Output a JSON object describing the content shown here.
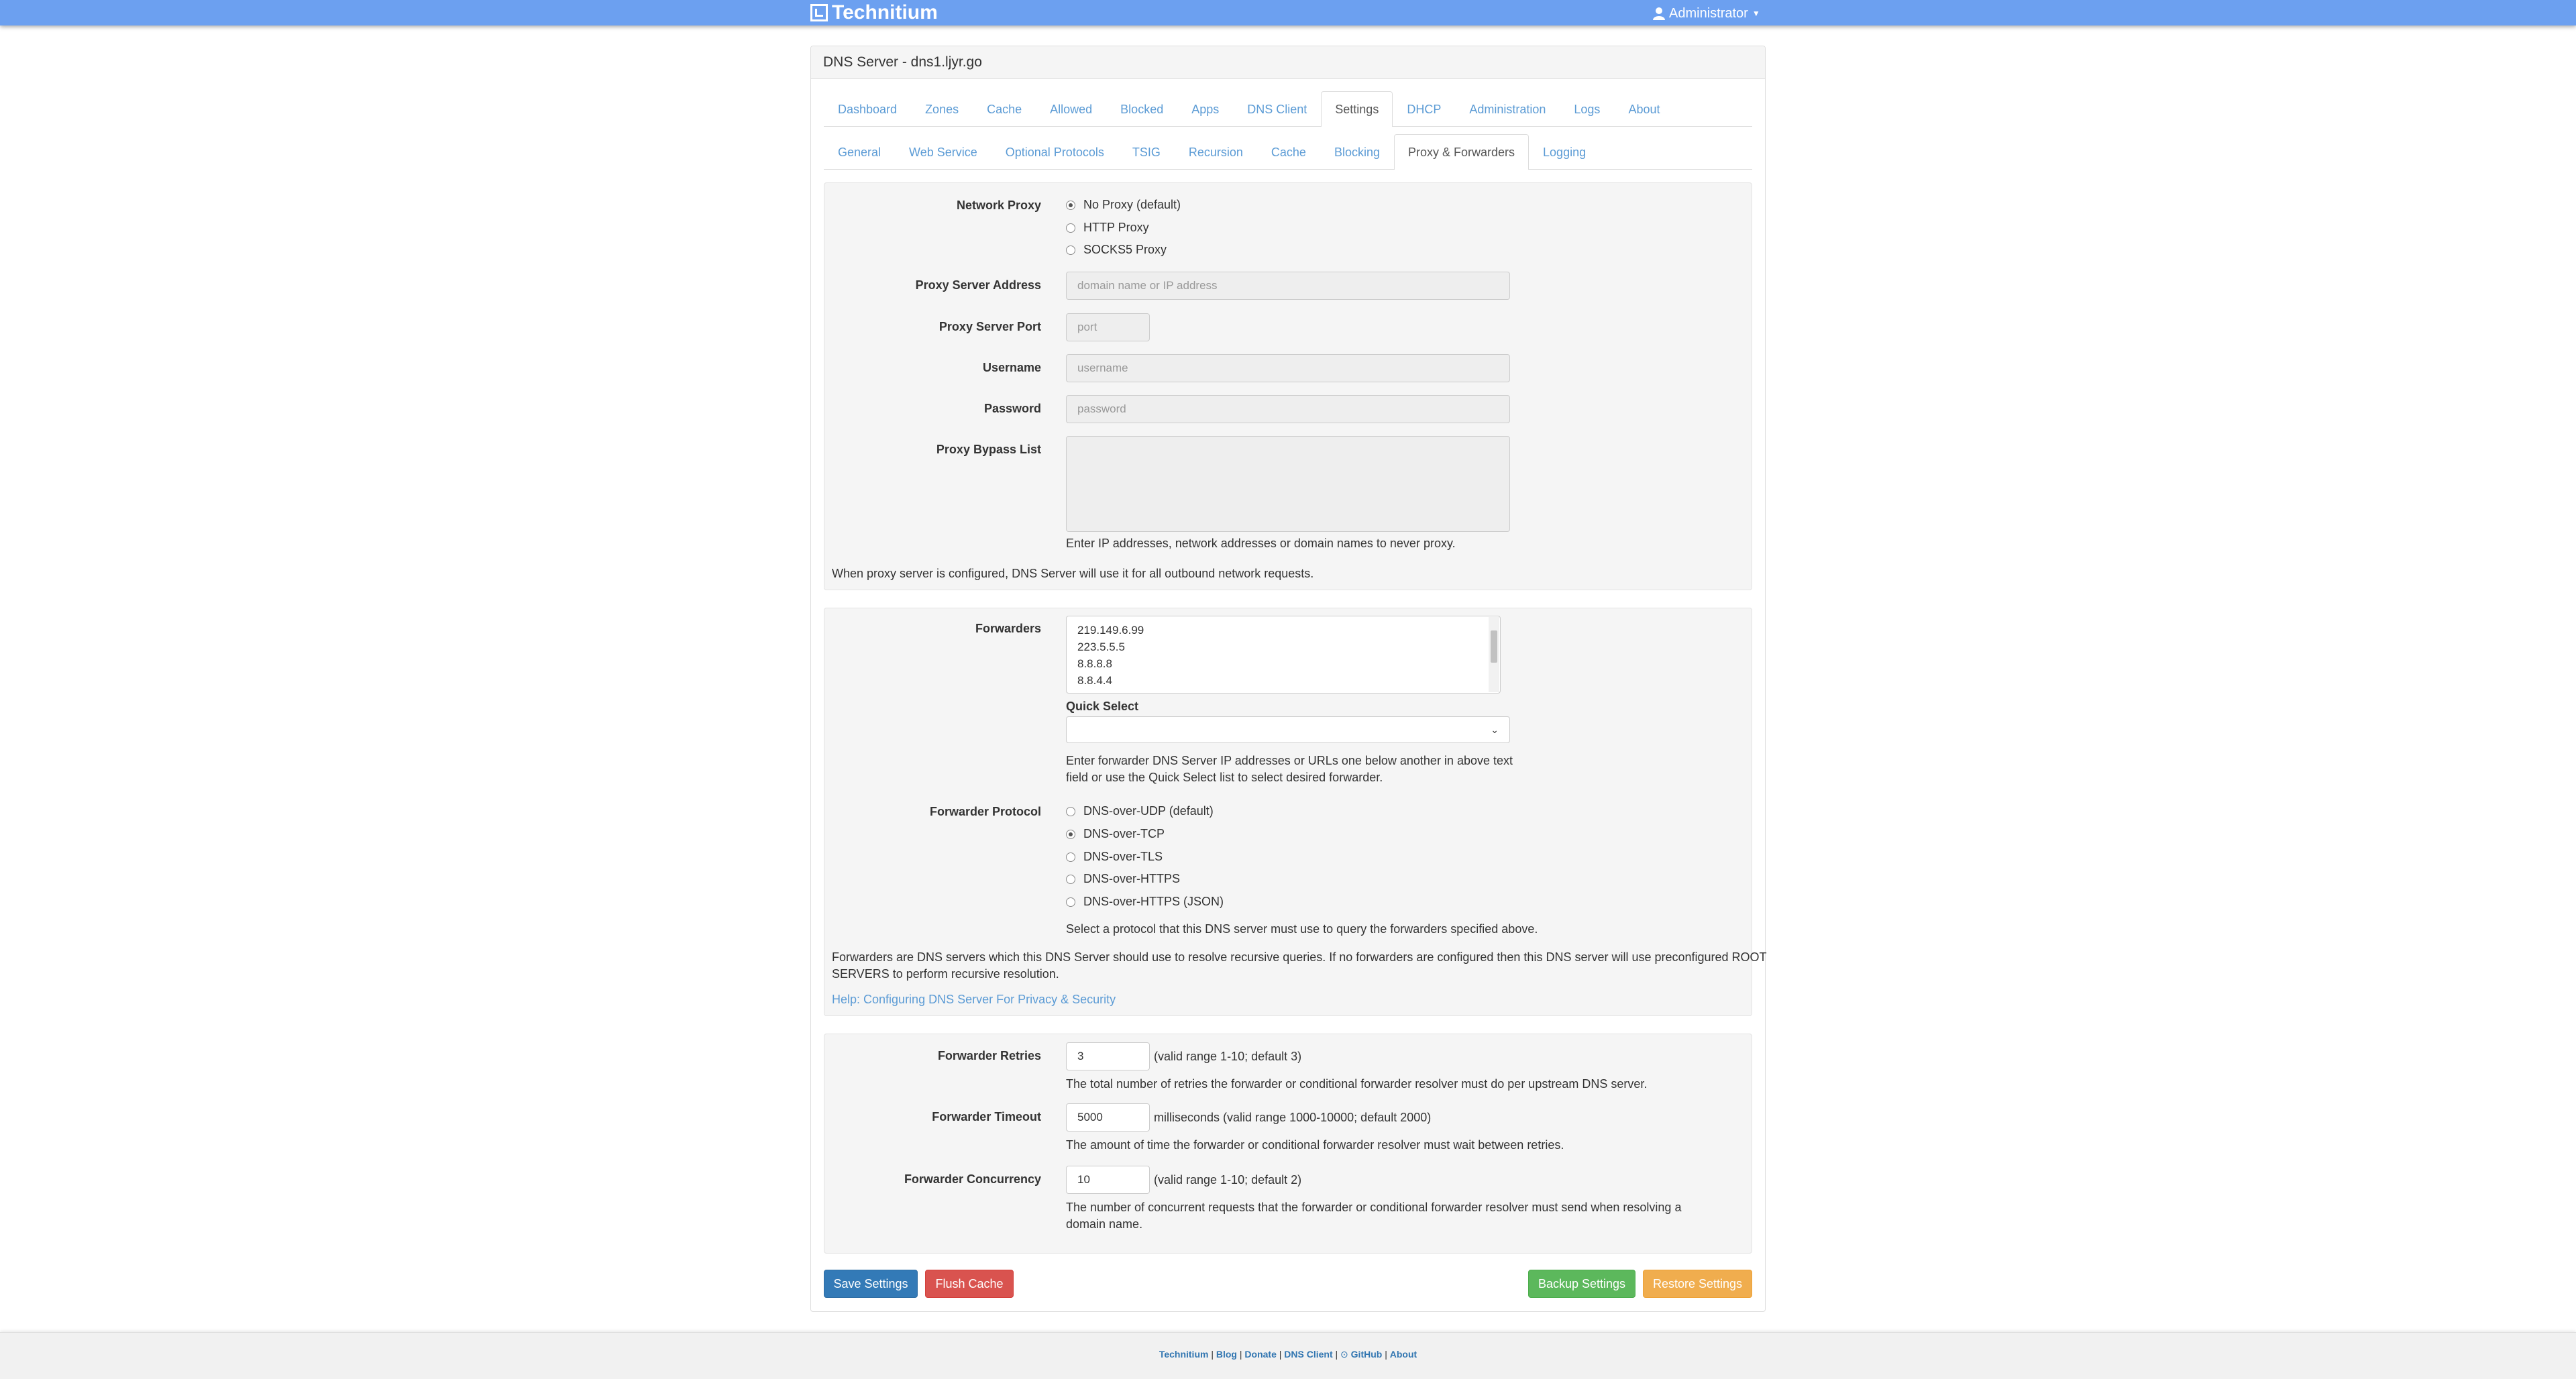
{
  "brand": {
    "name": "Technitium"
  },
  "user_menu": {
    "label": "Administrator"
  },
  "panel": {
    "title": "DNS Server - dns1.ljyr.go"
  },
  "main_tabs": [
    {
      "label": "Dashboard"
    },
    {
      "label": "Zones"
    },
    {
      "label": "Cache"
    },
    {
      "label": "Allowed"
    },
    {
      "label": "Blocked"
    },
    {
      "label": "Apps"
    },
    {
      "label": "DNS Client"
    },
    {
      "label": "Settings",
      "active": true
    },
    {
      "label": "DHCP"
    },
    {
      "label": "Administration"
    },
    {
      "label": "Logs"
    },
    {
      "label": "About"
    }
  ],
  "sub_tabs": [
    {
      "label": "General"
    },
    {
      "label": "Web Service"
    },
    {
      "label": "Optional Protocols"
    },
    {
      "label": "TSIG"
    },
    {
      "label": "Recursion"
    },
    {
      "label": "Cache"
    },
    {
      "label": "Blocking"
    },
    {
      "label": "Proxy & Forwarders",
      "active": true
    },
    {
      "label": "Logging"
    }
  ],
  "proxy": {
    "network_proxy_label": "Network Proxy",
    "options": [
      {
        "label": "No Proxy (default)",
        "checked": true
      },
      {
        "label": "HTTP Proxy",
        "checked": false
      },
      {
        "label": "SOCKS5 Proxy",
        "checked": false
      }
    ],
    "address_label": "Proxy Server Address",
    "address_placeholder": "domain name or IP address",
    "port_label": "Proxy Server Port",
    "port_placeholder": "port",
    "username_label": "Username",
    "username_placeholder": "username",
    "password_label": "Password",
    "password_placeholder": "password",
    "bypass_label": "Proxy Bypass List",
    "bypass_help": "Enter IP addresses, network addresses or domain names to never proxy.",
    "note": "When proxy server is configured, DNS Server will use it for all outbound network requests."
  },
  "forwarders": {
    "label": "Forwarders",
    "values": [
      "219.149.6.99",
      "223.5.5.5",
      "8.8.8.8",
      "8.8.4.4"
    ],
    "quick_select_label": "Quick Select",
    "quick_select_value": "",
    "help_line1": "Enter forwarder DNS Server IP addresses or URLs one below another in above text",
    "help_line2": "field or use the Quick Select list to select desired forwarder.",
    "protocol_label": "Forwarder Protocol",
    "protocols": [
      {
        "label": "DNS-over-UDP (default)",
        "checked": false
      },
      {
        "label": "DNS-over-TCP",
        "checked": true
      },
      {
        "label": "DNS-over-TLS",
        "checked": false
      },
      {
        "label": "DNS-over-HTTPS",
        "checked": false
      },
      {
        "label": "DNS-over-HTTPS (JSON)",
        "checked": false
      }
    ],
    "protocol_help": "Select a protocol that this DNS server must use to query the forwarders specified above.",
    "note_line1": "Forwarders are DNS servers which this DNS Server should use to resolve recursive queries. If no forwarders are configured then this DNS server will use preconfigured ROOT",
    "note_line2": "SERVERS to perform recursive resolution.",
    "help_link": "Help: Configuring DNS Server For Privacy & Security"
  },
  "forwarder_settings": {
    "retries_label": "Forwarder Retries",
    "retries_value": "3",
    "retries_range": "(valid range 1-10; default 3)",
    "retries_help": "The total number of retries the forwarder or conditional forwarder resolver must do per upstream DNS server.",
    "timeout_label": "Forwarder Timeout",
    "timeout_value": "5000",
    "timeout_range": "milliseconds (valid range 1000-10000; default 2000)",
    "timeout_help": "The amount of time the forwarder or conditional forwarder resolver must wait between retries.",
    "concurrency_label": "Forwarder Concurrency",
    "concurrency_value": "10",
    "concurrency_range": "(valid range 1-10; default 2)",
    "concurrency_help_line1": "The number of concurrent requests that the forwarder or conditional forwarder resolver must send when resolving a",
    "concurrency_help_line2": "domain name."
  },
  "buttons": {
    "save": "Save Settings",
    "flush": "Flush Cache",
    "backup": "Backup Settings",
    "restore": "Restore Settings"
  },
  "footer": {
    "links": [
      "Technitium",
      "Blog",
      "Donate",
      "DNS Client",
      "GitHub",
      "About"
    ],
    "separator": "|"
  },
  "colors": {
    "topbar": "#6ca0f0",
    "link": "#5b9bd5",
    "primary": "#337ab7",
    "danger": "#d9534f",
    "success": "#5cb85c",
    "warning": "#f0ad4e"
  },
  "icons": {
    "brand": "technitium-logo-icon",
    "user": "user-icon",
    "caret": "caret-down-icon",
    "github": "github-icon"
  }
}
